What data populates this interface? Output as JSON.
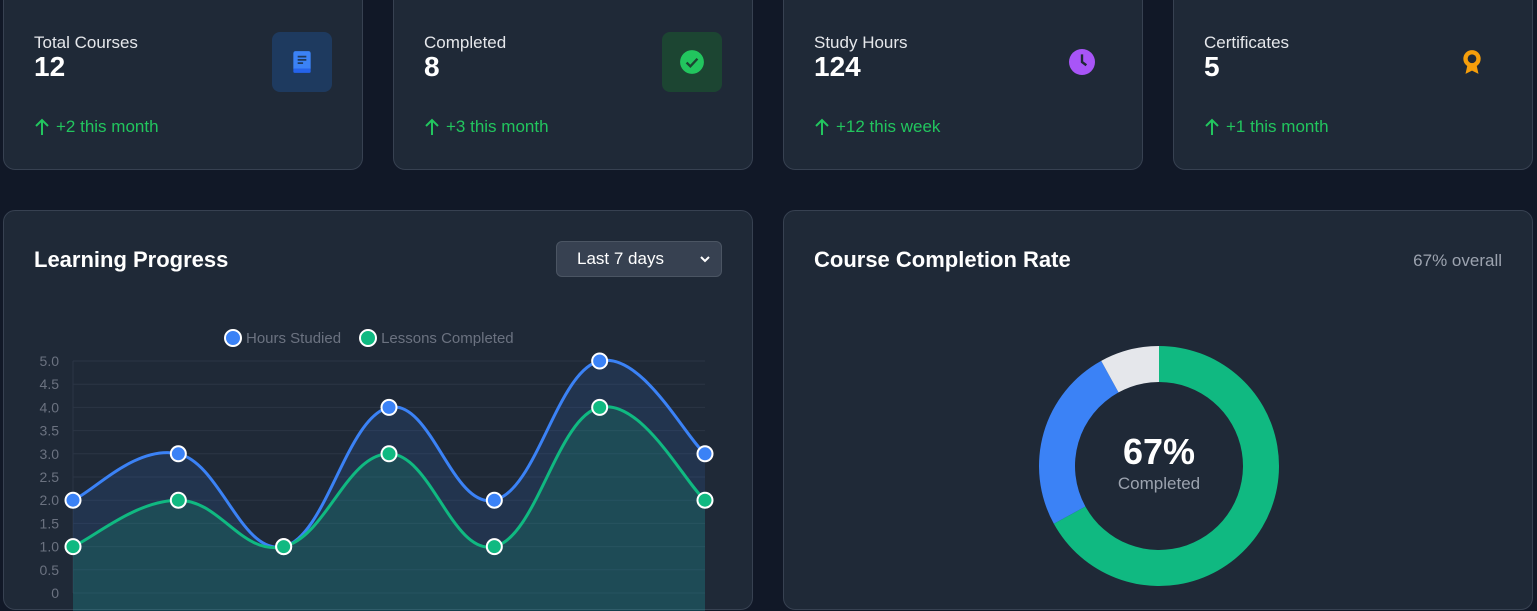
{
  "stats": [
    {
      "title": "Total Courses",
      "value": "12",
      "change": "+2 this month",
      "icon": "book-icon",
      "icon_color": "#3b82f6",
      "icon_bg": "#1e3a5f"
    },
    {
      "title": "Completed",
      "value": "8",
      "change": "+3 this month",
      "icon": "check-circle-icon",
      "icon_color": "#22c55e",
      "icon_bg": "#1c4532"
    },
    {
      "title": "Study Hours",
      "value": "124",
      "change": "+12 this week",
      "icon": "clock-icon",
      "icon_color": "#a855f7",
      "icon_bg": "#1f2937"
    },
    {
      "title": "Certificates",
      "value": "5",
      "change": "+1 this month",
      "icon": "award-icon",
      "icon_color": "#f59e0b",
      "icon_bg": "#1f2937"
    }
  ],
  "progress": {
    "title": "Learning Progress",
    "range_select": "Last 7 days"
  },
  "completion": {
    "title": "Course Completion Rate",
    "overall": "67% overall",
    "center_value": "67%",
    "center_label": "Completed"
  },
  "chart_data": [
    {
      "type": "area",
      "x": [
        1,
        2,
        3,
        4,
        5,
        6,
        7
      ],
      "series": [
        {
          "name": "Hours Studied",
          "values": [
            2,
            3,
            1,
            4,
            2,
            5,
            3
          ],
          "color": "#3b82f6"
        },
        {
          "name": "Lessons Completed",
          "values": [
            1,
            2,
            1,
            3,
            1,
            4,
            2
          ],
          "color": "#10b981"
        }
      ],
      "yticks": [
        "5.0",
        "4.5",
        "4.0",
        "3.5",
        "3.0",
        "2.5",
        "2.0",
        "1.5",
        "1.0",
        "0.5",
        "0"
      ],
      "ylim": [
        0,
        5
      ],
      "legend": "top",
      "grid": true
    },
    {
      "type": "pie",
      "values": [
        67,
        25,
        8
      ],
      "colors": [
        "#10b981",
        "#3b82f6",
        "#e5e7eb"
      ]
    }
  ]
}
